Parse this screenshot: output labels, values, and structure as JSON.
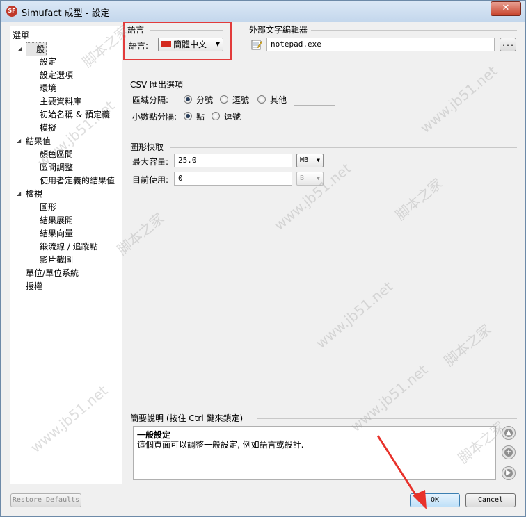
{
  "window": {
    "title": "Simufact 成型 - 設定",
    "app_icon_text": "SF",
    "close_glyph": "✕"
  },
  "tree": {
    "header": "選單",
    "items": [
      {
        "label": "一般",
        "level": 0,
        "expanded": true,
        "selected": true
      },
      {
        "label": "設定",
        "level": 1
      },
      {
        "label": "設定選項",
        "level": 1
      },
      {
        "label": "環境",
        "level": 1
      },
      {
        "label": "主要資料庫",
        "level": 1
      },
      {
        "label": "初始名稱 & 預定義",
        "level": 1
      },
      {
        "label": "模擬",
        "level": 1
      },
      {
        "label": "結果值",
        "level": 0,
        "expanded": true
      },
      {
        "label": "顏色區間",
        "level": 1
      },
      {
        "label": "區間調整",
        "level": 1
      },
      {
        "label": "使用者定義的結果值",
        "level": 1
      },
      {
        "label": "檢視",
        "level": 0,
        "expanded": true
      },
      {
        "label": "圖形",
        "level": 1
      },
      {
        "label": "結果展開",
        "level": 1
      },
      {
        "label": "結果向量",
        "level": 1
      },
      {
        "label": "鍛流線 / 追蹤點",
        "level": 1
      },
      {
        "label": "影片截圖",
        "level": 1
      },
      {
        "label": "單位/單位系統",
        "level": 0
      },
      {
        "label": "授權",
        "level": 0
      }
    ]
  },
  "language": {
    "group_title": "語言",
    "label": "語言:",
    "selected": "簡體中文",
    "highlight_color": "#e23b3b"
  },
  "editor": {
    "group_title": "外部文字編輯器",
    "value": "notepad.exe",
    "browse_label": "..."
  },
  "csv": {
    "group_title": "CSV 匯出選項",
    "field_sep_label": "區域分隔:",
    "field_sep_options": [
      "分號",
      "逗號",
      "其他"
    ],
    "field_sep_selected": "分號",
    "other_value": "",
    "decimal_sep_label": "小數點分隔:",
    "decimal_sep_options": [
      "點",
      "逗號"
    ],
    "decimal_sep_selected": "點"
  },
  "cache": {
    "group_title": "圖形快取",
    "max_label": "最大容量:",
    "max_value": "25.0",
    "max_unit": "MB",
    "current_label": "目前使用:",
    "current_value": "0",
    "current_unit": "B"
  },
  "summary": {
    "group_title": "簡要說明 (按住 Ctrl 鍵來鎖定)",
    "heading": "一般設定",
    "text": "這個頁面可以調整一般設定, 例如語言或設計."
  },
  "buttons": {
    "restore": "Restore Defaults",
    "ok": "OK",
    "cancel": "Cancel"
  },
  "watermark": {
    "text_latin": "www.jb51.net",
    "text_cjk": "脚本之家"
  }
}
